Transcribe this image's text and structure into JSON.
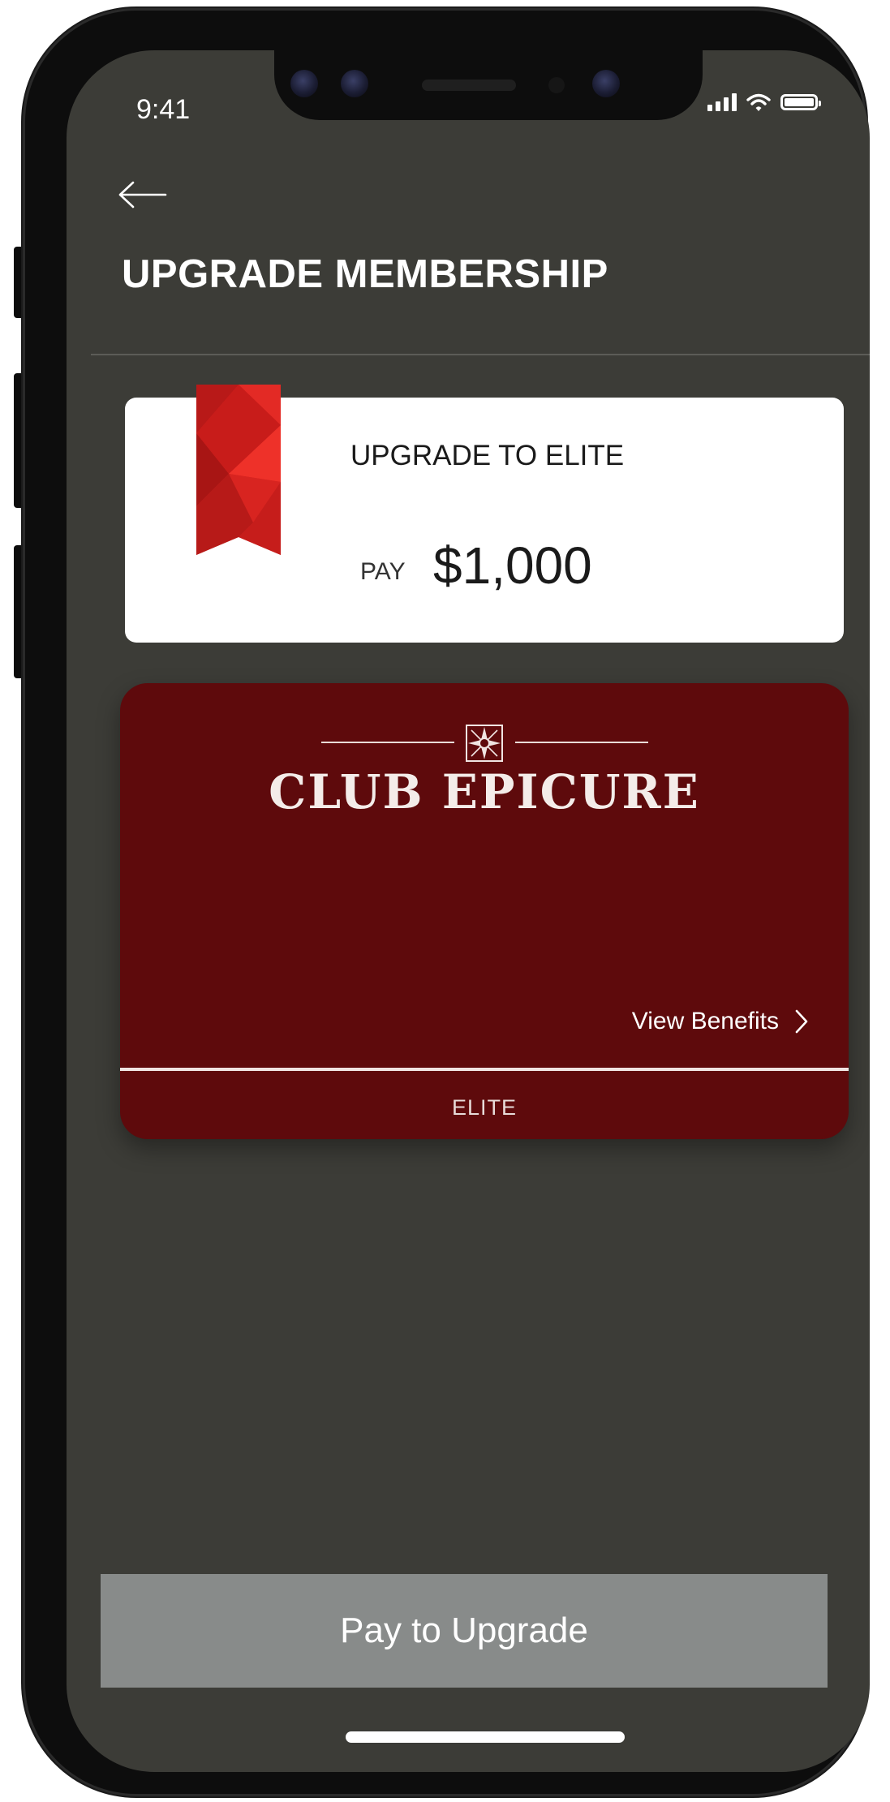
{
  "status_bar": {
    "time": "9:41"
  },
  "header": {
    "title": "UPGRADE MEMBERSHIP"
  },
  "upgrade_card": {
    "label": "UPGRADE TO ELITE",
    "pay_word": "PAY",
    "amount": "$1,000"
  },
  "club_card": {
    "name": "CLUB EPICURE",
    "view_benefits": "View Benefits",
    "tier": "ELITE"
  },
  "footer": {
    "pay_button": "Pay to Upgrade"
  },
  "colors": {
    "screen_bg": "#3c3c37",
    "card_red": "#5e0a0c",
    "ribbon_red": "#d3201e",
    "button_gray": "#888b8a"
  },
  "icons": [
    "back-arrow-icon",
    "signal-icon",
    "wifi-icon",
    "battery-icon",
    "ribbon-icon",
    "club-emblem-icon",
    "chevron-right-icon"
  ]
}
